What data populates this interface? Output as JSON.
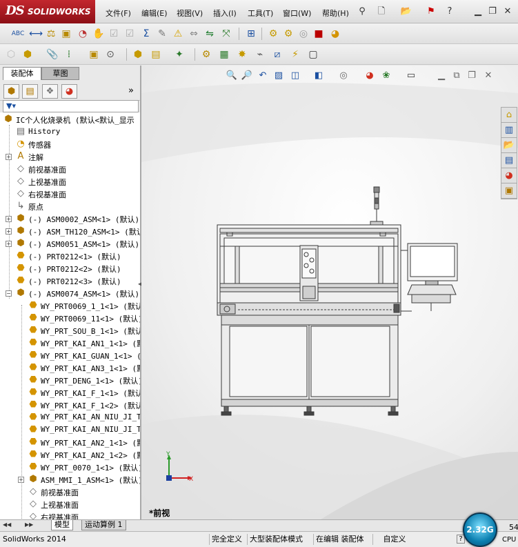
{
  "app": {
    "brand": "SOLIDWORKS",
    "brand_mark": "DS",
    "menus": [
      "文件(F)",
      "编辑(E)",
      "视图(V)",
      "插入(I)",
      "工具(T)",
      "窗口(W)",
      "帮助(H)"
    ],
    "window_controls": [
      "minimize",
      "restore",
      "close"
    ]
  },
  "left_pane": {
    "tabs": [
      "装配体",
      "草图"
    ],
    "pane_icons": [
      "featuremanager-icon",
      "propertymanager-icon",
      "configurationmanager-icon",
      "display-manager-icon"
    ],
    "expand_glyph": "»",
    "tree": [
      {
        "indent": 0,
        "expander": "none",
        "icon": "assembly-icon",
        "label": "IC个人化烧录机  (默认<默认_显示"
      },
      {
        "indent": 1,
        "expander": "none",
        "icon": "history-icon",
        "label": "History"
      },
      {
        "indent": 1,
        "expander": "none",
        "icon": "sensor-icon",
        "label": "传感器"
      },
      {
        "indent": 1,
        "expander": "plus",
        "icon": "annotation-icon",
        "label": "注解"
      },
      {
        "indent": 1,
        "expander": "none",
        "icon": "plane-icon",
        "label": "前视基准面"
      },
      {
        "indent": 1,
        "expander": "none",
        "icon": "plane-icon",
        "label": "上视基准面"
      },
      {
        "indent": 1,
        "expander": "none",
        "icon": "plane-icon",
        "label": "右视基准面"
      },
      {
        "indent": 1,
        "expander": "none",
        "icon": "origin-icon",
        "label": "原点"
      },
      {
        "indent": 1,
        "expander": "plus",
        "icon": "assembly-icon",
        "label": "(-) ASM0002_ASM<1> (默认)"
      },
      {
        "indent": 1,
        "expander": "plus",
        "icon": "assembly-icon",
        "label": "(-) ASM_TH120_ASM<1> (默认)"
      },
      {
        "indent": 1,
        "expander": "plus",
        "icon": "assembly-icon",
        "label": "(-) ASM0051_ASM<1> (默认)"
      },
      {
        "indent": 1,
        "expander": "none",
        "icon": "part-icon",
        "label": "(-) PRT0212<1> (默认)"
      },
      {
        "indent": 1,
        "expander": "none",
        "icon": "part-icon",
        "label": "(-) PRT0212<2> (默认)"
      },
      {
        "indent": 1,
        "expander": "none",
        "icon": "part-icon",
        "label": "(-) PRT0212<3> (默认)"
      },
      {
        "indent": 1,
        "expander": "minus",
        "icon": "assembly-icon",
        "label": "(-) ASM0074_ASM<1> (默认)"
      },
      {
        "indent": 2,
        "expander": "none",
        "icon": "part-icon",
        "label": "WY_PRT0069_1_1<1> (默认)"
      },
      {
        "indent": 2,
        "expander": "none",
        "icon": "part-icon",
        "label": "WY_PRT0069_11<1> (默认)"
      },
      {
        "indent": 2,
        "expander": "none",
        "icon": "part-icon",
        "label": "WY_PRT_SOU_B_1<1> (默认)"
      },
      {
        "indent": 2,
        "expander": "none",
        "icon": "part-icon",
        "label": "WY_PRT_KAI_AN1_1<1> (默"
      },
      {
        "indent": 2,
        "expander": "none",
        "icon": "part-icon",
        "label": "WY_PRT_KAI_GUAN_1<1> (默"
      },
      {
        "indent": 2,
        "expander": "none",
        "icon": "part-icon",
        "label": "WY_PRT_KAI_AN3_1<1> (默认"
      },
      {
        "indent": 2,
        "expander": "none",
        "icon": "part-icon",
        "label": "WY_PRT_DENG_1<1> (默认)"
      },
      {
        "indent": 2,
        "expander": "none",
        "icon": "part-icon",
        "label": "WY_PRT_KAI_F_1<1> (默认)"
      },
      {
        "indent": 2,
        "expander": "none",
        "icon": "part-icon",
        "label": "WY_PRT_KAI_F_1<2> (默认)"
      },
      {
        "indent": 2,
        "expander": "none",
        "icon": "part-icon",
        "label": "WY_PRT_KAI_AN_NIU_JI_TII"
      },
      {
        "indent": 2,
        "expander": "none",
        "icon": "part-icon",
        "label": "WY_PRT_KAI_AN_NIU_JI_TII"
      },
      {
        "indent": 2,
        "expander": "none",
        "icon": "part-icon",
        "label": "WY_PRT_KAI_AN2_1<1> (默认"
      },
      {
        "indent": 2,
        "expander": "none",
        "icon": "part-icon",
        "label": "WY_PRT_KAI_AN2_1<2> (默认"
      },
      {
        "indent": 2,
        "expander": "none",
        "icon": "part-icon",
        "label": "WY_PRT_0070_1<1> (默认)"
      },
      {
        "indent": 2,
        "expander": "plus",
        "icon": "assembly-icon",
        "label": "ASM_MMI_1_ASM<1> (默认)"
      },
      {
        "indent": 2,
        "expander": "none",
        "icon": "plane-icon",
        "label": "前视基准面"
      },
      {
        "indent": 2,
        "expander": "none",
        "icon": "plane-icon",
        "label": "上视基准面"
      },
      {
        "indent": 2,
        "expander": "none",
        "icon": "plane-icon",
        "label": "右视基准面"
      }
    ]
  },
  "graphics": {
    "view_label": "*前视",
    "triad": {
      "x": "X",
      "y": "Y"
    }
  },
  "bottom_tabs": [
    "模型",
    "运动算例 1"
  ],
  "status": {
    "app_version": "SolidWorks 2014",
    "fully_defined": "完全定义",
    "large_assembly": "大型装配体模式",
    "editing": "在编辑 装配体",
    "custom": "自定义",
    "help": "?",
    "cpu_value": "2.32G",
    "right_number": "54",
    "right_cpu": "CPU"
  },
  "colors": {
    "brand_red": "#b3202a",
    "status_ok": "#1c8a3a"
  }
}
